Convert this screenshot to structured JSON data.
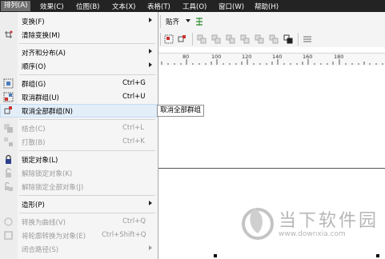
{
  "menubar": {
    "items": [
      "排列(A)",
      "效果(C)",
      "位图(B)",
      "文本(X)",
      "表格(T)",
      "工具(O)",
      "窗口(W)",
      "帮助(H)"
    ]
  },
  "toolbar": {
    "snap_label": "贴齐"
  },
  "ruler": {
    "ticks": [
      "80",
      "100",
      "120",
      "140",
      "160",
      "180"
    ]
  },
  "menu": {
    "items": [
      {
        "label": "变换(F)",
        "shortcut": "",
        "submenu": true,
        "disabled": false
      },
      {
        "label": "清除变换(M)",
        "shortcut": "",
        "submenu": false,
        "disabled": false
      },
      {
        "label": "对齐和分布(A)",
        "shortcut": "",
        "submenu": true,
        "disabled": false
      },
      {
        "label": "顺序(O)",
        "shortcut": "",
        "submenu": true,
        "disabled": false
      },
      {
        "label": "群组(G)",
        "shortcut": "Ctrl+G",
        "submenu": false,
        "disabled": false
      },
      {
        "label": "取消群组(U)",
        "shortcut": "Ctrl+U",
        "submenu": false,
        "disabled": false
      },
      {
        "label": "取消全部群组(N)",
        "shortcut": "",
        "submenu": false,
        "disabled": false,
        "highlighted": true
      },
      {
        "label": "结合(C)",
        "shortcut": "Ctrl+L",
        "submenu": false,
        "disabled": true
      },
      {
        "label": "打散(B)",
        "shortcut": "Ctrl+K",
        "submenu": false,
        "disabled": true
      },
      {
        "label": "锁定对象(L)",
        "shortcut": "",
        "submenu": false,
        "disabled": false
      },
      {
        "label": "解除锁定对象(K)",
        "shortcut": "",
        "submenu": false,
        "disabled": true
      },
      {
        "label": "解除锁定全部对象(J)",
        "shortcut": "",
        "submenu": false,
        "disabled": true
      },
      {
        "label": "造形(P)",
        "shortcut": "",
        "submenu": true,
        "disabled": false
      },
      {
        "label": "转换为曲线(V)",
        "shortcut": "Ctrl+Q",
        "submenu": false,
        "disabled": true
      },
      {
        "label": "将轮廓转换为对象(E)",
        "shortcut": "Ctrl+Shift+Q",
        "submenu": false,
        "disabled": true
      },
      {
        "label": "闭合路径(S)",
        "shortcut": "",
        "submenu": true,
        "disabled": true
      }
    ]
  },
  "tooltip": {
    "text": "取消全部群组"
  },
  "watermark": {
    "title": "当下软件园",
    "url": "www.downxia.com"
  },
  "colors": {
    "menubar_bg": "#232323",
    "menu_highlight": "#e3eef9",
    "disabled_text": "#9a9a9a"
  }
}
